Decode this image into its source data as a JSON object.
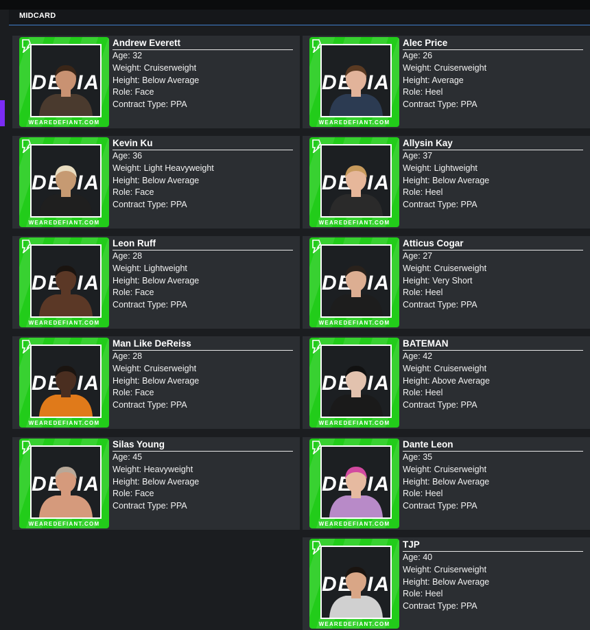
{
  "section": {
    "title": "MIDCARD"
  },
  "portrait": {
    "watermark": "WEAREDEFIANT.COM",
    "logo_text": "DEFIANT"
  },
  "labels": {
    "age": "Age: ",
    "weight": "Weight: ",
    "height": "Height: ",
    "role": "Role: ",
    "contract": "Contract Type: "
  },
  "wrestlers": [
    {
      "name": "Andrew Everett",
      "age": "32",
      "weight": "Cruiserweight",
      "height": "Below Average",
      "role": "Face",
      "contract": "PPA",
      "skin": "#c99272",
      "hair": "#3a2618",
      "top": "#4a3a2e"
    },
    {
      "name": "Alec Price",
      "age": "26",
      "weight": "Cruiserweight",
      "height": "Average",
      "role": "Heel",
      "contract": "PPA",
      "skin": "#e2b39a",
      "hair": "#5a3a22",
      "top": "#2c3b52"
    },
    {
      "name": "Kevin Ku",
      "age": "36",
      "weight": "Light Heavyweight",
      "height": "Below Average",
      "role": "Face",
      "contract": "PPA",
      "skin": "#c69a72",
      "hair": "#e8dcc0",
      "top": "#1f1f1f"
    },
    {
      "name": "Allysin Kay",
      "age": "37",
      "weight": "Lightweight",
      "height": "Below Average",
      "role": "Heel",
      "contract": "PPA",
      "skin": "#e6b79a",
      "hair": "#c79a5c",
      "top": "#2a2a2a"
    },
    {
      "name": "Leon Ruff",
      "age": "28",
      "weight": "Lightweight",
      "height": "Below Average",
      "role": "Face",
      "contract": "PPA",
      "skin": "#5b3826",
      "hair": "#1a1410",
      "top": "#5b3826"
    },
    {
      "name": "Atticus Cogar",
      "age": "27",
      "weight": "Cruiserweight",
      "height": "Very Short",
      "role": "Heel",
      "contract": "PPA",
      "skin": "#dcae92",
      "hair": "#2a221c",
      "top": "#1d1d1d"
    },
    {
      "name": "Man Like DeReiss",
      "age": "28",
      "weight": "Cruiserweight",
      "height": "Below Average",
      "role": "Face",
      "contract": "PPA",
      "skin": "#4a2e20",
      "hair": "#1a1410",
      "top": "#e07a1a"
    },
    {
      "name": "BATEMAN",
      "age": "42",
      "weight": "Cruiserweight",
      "height": "Above Average",
      "role": "Heel",
      "contract": "PPA",
      "skin": "#e2c2ae",
      "hair": "#111111",
      "top": "#1a1a1a"
    },
    {
      "name": "Silas Young",
      "age": "45",
      "weight": "Heavyweight",
      "height": "Below Average",
      "role": "Face",
      "contract": "PPA",
      "skin": "#d59a7c",
      "hair": "#b8a898",
      "top": "#d59a7c"
    },
    {
      "name": "Dante Leon",
      "age": "35",
      "weight": "Cruiserweight",
      "height": "Below Average",
      "role": "Heel",
      "contract": "PPA",
      "skin": "#e6baa0",
      "hair": "#d24aa0",
      "top": "#b88ac8"
    },
    {
      "name": "TJP",
      "age": "40",
      "weight": "Cruiserweight",
      "height": "Below Average",
      "role": "Heel",
      "contract": "PPA",
      "skin": "#d9a686",
      "hair": "#1a1410",
      "top": "#d0d0d0"
    }
  ]
}
